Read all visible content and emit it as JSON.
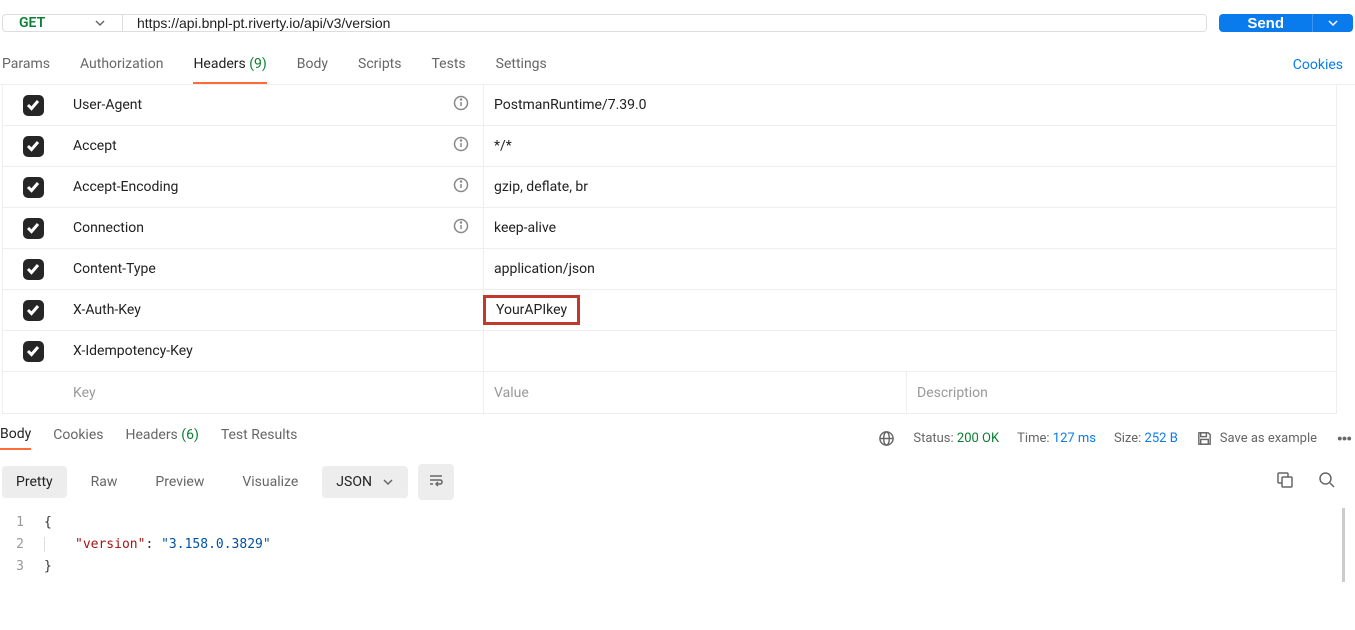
{
  "request": {
    "method": "GET",
    "url": "https://api.bnpl-pt.riverty.io/api/v3/version",
    "send_label": "Send"
  },
  "tabs": {
    "params": "Params",
    "authorization": "Authorization",
    "headers": "Headers",
    "headers_count": "(9)",
    "body": "Body",
    "scripts": "Scripts",
    "tests": "Tests",
    "settings": "Settings",
    "cookies": "Cookies"
  },
  "headers": [
    {
      "key": "User-Agent",
      "value": "PostmanRuntime/7.39.0",
      "info": true
    },
    {
      "key": "Accept",
      "value": "*/*",
      "info": true
    },
    {
      "key": "Accept-Encoding",
      "value": "gzip, deflate, br",
      "info": true
    },
    {
      "key": "Connection",
      "value": "keep-alive",
      "info": true
    },
    {
      "key": "Content-Type",
      "value": "application/json",
      "info": false
    },
    {
      "key": "X-Auth-Key",
      "value": "YourAPIkey",
      "info": false,
      "highlight": true
    },
    {
      "key": "X-Idempotency-Key",
      "value": "",
      "info": false
    }
  ],
  "header_placeholders": {
    "key": "Key",
    "value": "Value",
    "description": "Description"
  },
  "response_tabs": {
    "body": "Body",
    "cookies": "Cookies",
    "headers": "Headers",
    "headers_count": "(6)",
    "test_results": "Test Results"
  },
  "response_meta": {
    "status_label": "Status:",
    "status_value": "200 OK",
    "time_label": "Time:",
    "time_value": "127 ms",
    "size_label": "Size:",
    "size_value": "252 B",
    "save_example": "Save as example"
  },
  "format_tabs": {
    "pretty": "Pretty",
    "raw": "Raw",
    "preview": "Preview",
    "visualize": "Visualize",
    "format_select": "JSON"
  },
  "response_body": {
    "lines": [
      "1",
      "2",
      "3"
    ],
    "open_brace": "{",
    "key": "\"version\"",
    "colon": ": ",
    "value": "\"3.158.0.3829\"",
    "close_brace": "}"
  }
}
